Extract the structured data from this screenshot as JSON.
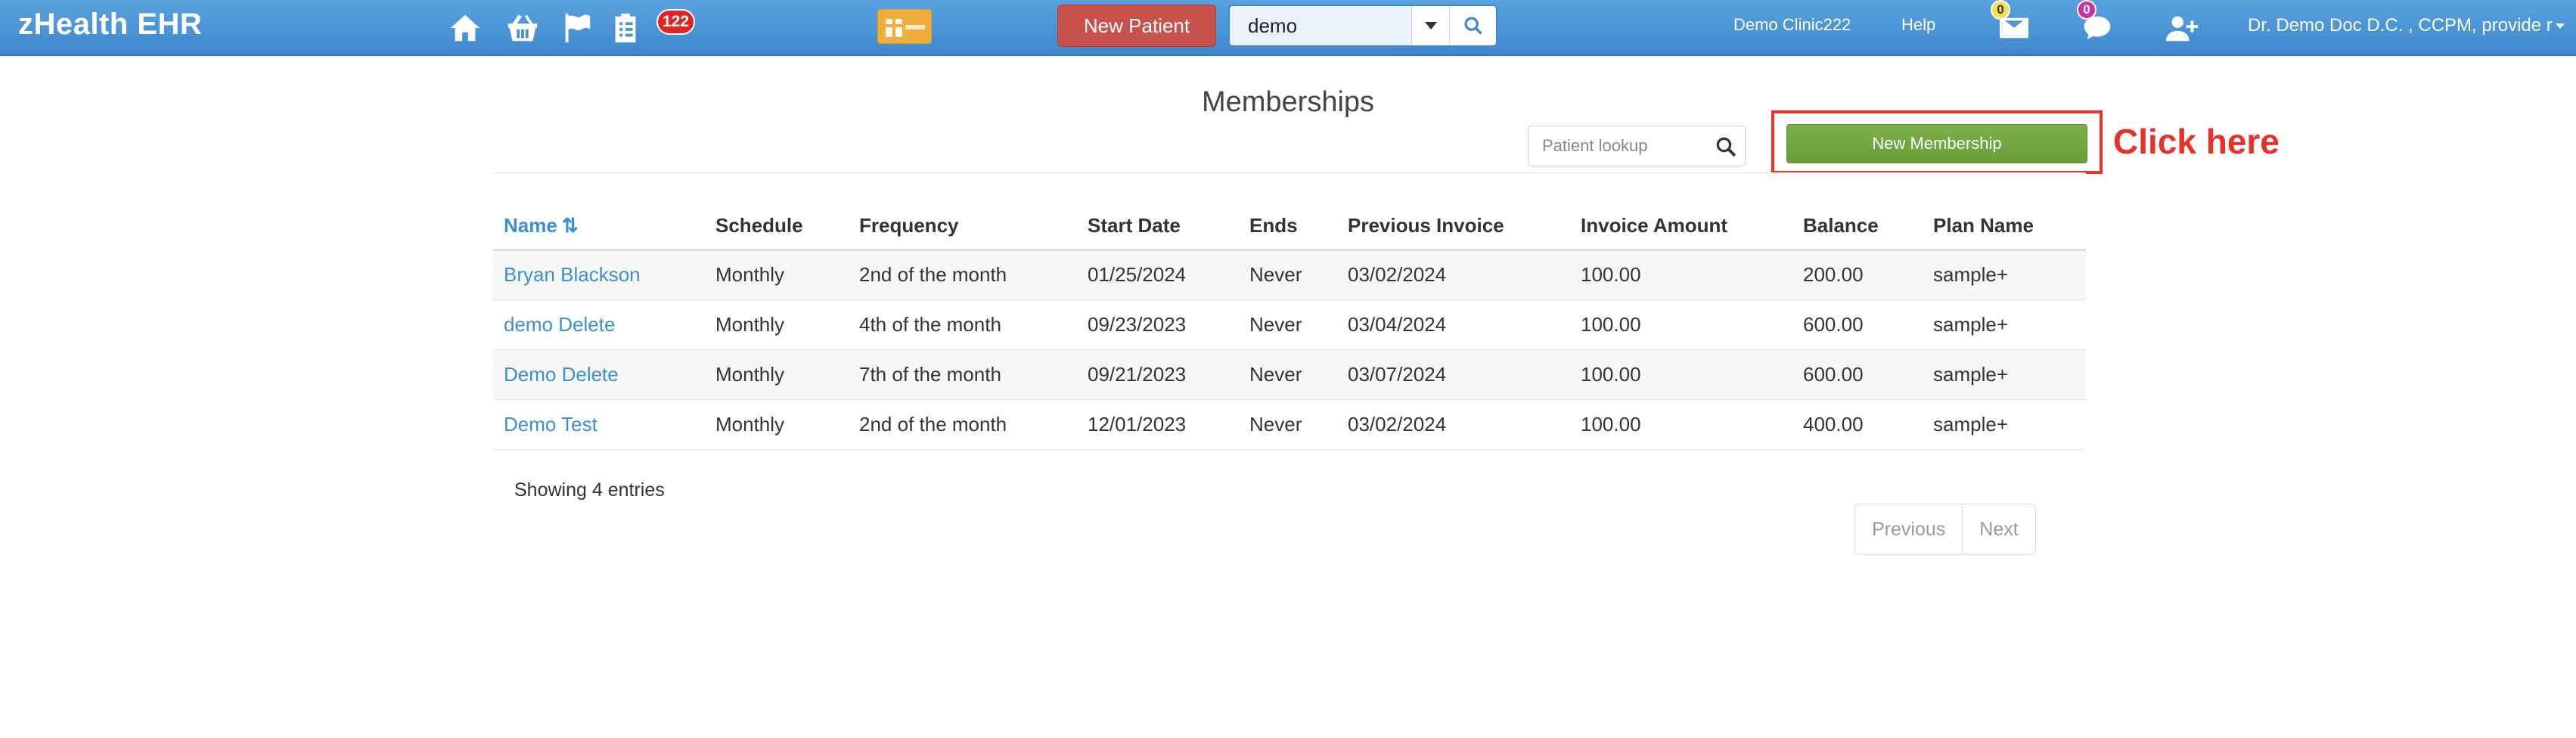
{
  "navbar": {
    "brand": "zHealth EHR",
    "icons": [
      "home-icon",
      "basket-icon",
      "flag-icon",
      "clipboard-icon"
    ],
    "notification_count": "122",
    "new_patient_label": "New Patient",
    "search_value": "demo",
    "clinic": "Demo Clinic222",
    "help": "Help",
    "mail_count": "0",
    "chat_count": "0",
    "user": "Dr. Demo Doc D.C. , CCPM, provide r",
    "colors": {
      "bar": "#4a94d6",
      "badge": "#e02424",
      "new_patient": "#c9524c",
      "gift": "#f2ae3a",
      "mail_dot": "#f3e34b",
      "chat_dot": "#c92fa6"
    }
  },
  "page": {
    "title": "Memberships",
    "lookup_placeholder": "Patient lookup",
    "new_membership_label": "New Membership",
    "callout": "Click here",
    "colors": {
      "link": "#3a8fd6",
      "button": "#72a641",
      "callout": "#e5332a"
    }
  },
  "table": {
    "columns": [
      "Name",
      "Schedule",
      "Frequency",
      "Start Date",
      "Ends",
      "Previous Invoice",
      "Invoice Amount",
      "Balance",
      "Plan Name"
    ],
    "sort_icon": "sort-icon",
    "rows": [
      [
        "Bryan Blackson",
        "Monthly",
        "2nd of the month",
        "01/25/2024",
        "Never",
        "03/02/2024",
        "100.00",
        "200.00",
        "sample+"
      ],
      [
        "demo Delete",
        "Monthly",
        "4th of the month",
        "09/23/2023",
        "Never",
        "03/04/2024",
        "100.00",
        "600.00",
        "sample+"
      ],
      [
        "Demo Delete",
        "Monthly",
        "7th of the month",
        "09/21/2023",
        "Never",
        "03/07/2024",
        "100.00",
        "600.00",
        "sample+"
      ],
      [
        "Demo Test",
        "Monthly",
        "2nd of the month",
        "12/01/2023",
        "Never",
        "03/02/2024",
        "100.00",
        "400.00",
        "sample+"
      ]
    ]
  },
  "footer": {
    "entries_info": "Showing 4 entries",
    "previous": "Previous",
    "next": "Next"
  }
}
